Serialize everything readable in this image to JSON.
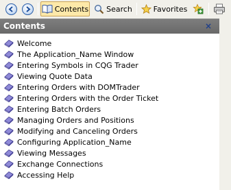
{
  "toolbar": {
    "back_label": "",
    "forward_label": "",
    "contents_label": "Contents",
    "search_label": "Search",
    "favorites_label": "Favorites"
  },
  "panel": {
    "title": "Contents",
    "close_glyph": "×"
  },
  "topics": [
    "Welcome",
    "The Application_Name Window",
    "Entering Symbols in CQG Trader",
    "Viewing Quote Data",
    "Entering Orders with DOMTrader",
    "Entering Orders with the Order Ticket",
    "Entering Batch Orders",
    "Managing Orders and Positions",
    "Modifying and Canceling Orders",
    "Configuring Application_Name",
    "Viewing Messages",
    "Exchange Connections",
    "Accessing Help"
  ],
  "colors": {
    "header_bg": "#6e6e6e",
    "active_tab_bg": "#fde9a9",
    "toolbar_bg": "#f1f0ea",
    "book_icon": "#5a55b5"
  },
  "icons": {
    "back": "arrow-left-icon",
    "forward": "arrow-right-icon",
    "contents": "book-icon",
    "search": "magnifier-icon",
    "favorites": "star-icon",
    "add_favorite": "add-favorite-icon",
    "print": "printer-icon",
    "topic": "book-page-icon"
  }
}
